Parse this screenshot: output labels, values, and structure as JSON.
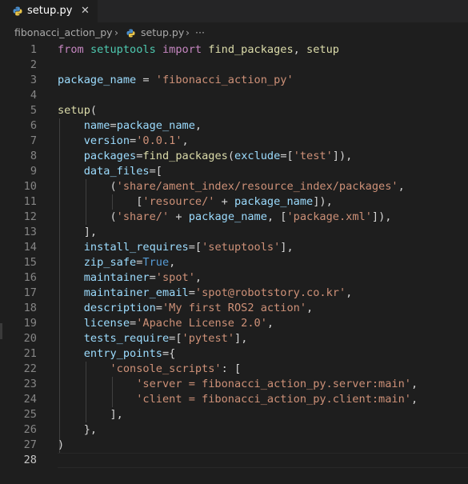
{
  "tab": {
    "label": "setup.py",
    "close": "✕"
  },
  "breadcrumb": {
    "folder": "fibonacci_action_py",
    "sep1": "›",
    "file": "setup.py",
    "sep2": "›",
    "more": "···"
  },
  "editor": {
    "lines": [
      {
        "n": "1",
        "tokens": [
          {
            "t": "from",
            "c": "kw"
          },
          {
            "t": " "
          },
          {
            "t": "setuptools",
            "c": "mod"
          },
          {
            "t": " "
          },
          {
            "t": "import",
            "c": "kw"
          },
          {
            "t": " "
          },
          {
            "t": "find_packages",
            "c": "fn"
          },
          {
            "t": ", "
          },
          {
            "t": "setup",
            "c": "fn"
          }
        ]
      },
      {
        "n": "2",
        "tokens": []
      },
      {
        "n": "3",
        "tokens": [
          {
            "t": "package_name",
            "c": "var"
          },
          {
            "t": " = "
          },
          {
            "t": "'fibonacci_action_py'",
            "c": "str"
          }
        ]
      },
      {
        "n": "4",
        "tokens": []
      },
      {
        "n": "5",
        "tokens": [
          {
            "t": "setup",
            "c": "fn"
          },
          {
            "t": "("
          }
        ]
      },
      {
        "n": "6",
        "tokens": [
          {
            "t": "    "
          },
          {
            "t": "name",
            "c": "var"
          },
          {
            "t": "="
          },
          {
            "t": "package_name",
            "c": "var"
          },
          {
            "t": ","
          }
        ]
      },
      {
        "n": "7",
        "tokens": [
          {
            "t": "    "
          },
          {
            "t": "version",
            "c": "var"
          },
          {
            "t": "="
          },
          {
            "t": "'0.0.1'",
            "c": "str"
          },
          {
            "t": ","
          }
        ]
      },
      {
        "n": "8",
        "tokens": [
          {
            "t": "    "
          },
          {
            "t": "packages",
            "c": "var"
          },
          {
            "t": "="
          },
          {
            "t": "find_packages",
            "c": "fn"
          },
          {
            "t": "("
          },
          {
            "t": "exclude",
            "c": "var"
          },
          {
            "t": "=["
          },
          {
            "t": "'test'",
            "c": "str"
          },
          {
            "t": "]),"
          }
        ]
      },
      {
        "n": "9",
        "tokens": [
          {
            "t": "    "
          },
          {
            "t": "data_files",
            "c": "var"
          },
          {
            "t": "=["
          }
        ]
      },
      {
        "n": "10",
        "tokens": [
          {
            "t": "        ("
          },
          {
            "t": "'share/ament_index/resource_index/packages'",
            "c": "str"
          },
          {
            "t": ","
          }
        ]
      },
      {
        "n": "11",
        "tokens": [
          {
            "t": "            ["
          },
          {
            "t": "'resource/'",
            "c": "str"
          },
          {
            "t": " + "
          },
          {
            "t": "package_name",
            "c": "var"
          },
          {
            "t": "]),"
          }
        ]
      },
      {
        "n": "12",
        "tokens": [
          {
            "t": "        ("
          },
          {
            "t": "'share/'",
            "c": "str"
          },
          {
            "t": " + "
          },
          {
            "t": "package_name",
            "c": "var"
          },
          {
            "t": ", ["
          },
          {
            "t": "'package.xml'",
            "c": "str"
          },
          {
            "t": "]),"
          }
        ]
      },
      {
        "n": "13",
        "tokens": [
          {
            "t": "    ],"
          }
        ]
      },
      {
        "n": "14",
        "tokens": [
          {
            "t": "    "
          },
          {
            "t": "install_requires",
            "c": "var"
          },
          {
            "t": "=["
          },
          {
            "t": "'setuptools'",
            "c": "str"
          },
          {
            "t": "],"
          }
        ]
      },
      {
        "n": "15",
        "tokens": [
          {
            "t": "    "
          },
          {
            "t": "zip_safe",
            "c": "var"
          },
          {
            "t": "="
          },
          {
            "t": "True",
            "c": "bool"
          },
          {
            "t": ","
          }
        ]
      },
      {
        "n": "16",
        "tokens": [
          {
            "t": "    "
          },
          {
            "t": "maintainer",
            "c": "var"
          },
          {
            "t": "="
          },
          {
            "t": "'spot'",
            "c": "str"
          },
          {
            "t": ","
          }
        ]
      },
      {
        "n": "17",
        "tokens": [
          {
            "t": "    "
          },
          {
            "t": "maintainer_email",
            "c": "var"
          },
          {
            "t": "="
          },
          {
            "t": "'spot@robotstory.co.kr'",
            "c": "str"
          },
          {
            "t": ","
          }
        ]
      },
      {
        "n": "18",
        "tokens": [
          {
            "t": "    "
          },
          {
            "t": "description",
            "c": "var"
          },
          {
            "t": "="
          },
          {
            "t": "'My first ROS2 action'",
            "c": "str"
          },
          {
            "t": ","
          }
        ]
      },
      {
        "n": "19",
        "tokens": [
          {
            "t": "    "
          },
          {
            "t": "license",
            "c": "var"
          },
          {
            "t": "="
          },
          {
            "t": "'Apache License 2.0'",
            "c": "str"
          },
          {
            "t": ","
          }
        ]
      },
      {
        "n": "20",
        "tokens": [
          {
            "t": "    "
          },
          {
            "t": "tests_require",
            "c": "var"
          },
          {
            "t": "=["
          },
          {
            "t": "'pytest'",
            "c": "str"
          },
          {
            "t": "],"
          }
        ]
      },
      {
        "n": "21",
        "tokens": [
          {
            "t": "    "
          },
          {
            "t": "entry_points",
            "c": "var"
          },
          {
            "t": "={"
          }
        ]
      },
      {
        "n": "22",
        "tokens": [
          {
            "t": "        "
          },
          {
            "t": "'console_scripts'",
            "c": "str"
          },
          {
            "t": ": ["
          }
        ]
      },
      {
        "n": "23",
        "tokens": [
          {
            "t": "            "
          },
          {
            "t": "'server = fibonacci_action_py.server:main'",
            "c": "str"
          },
          {
            "t": ","
          }
        ]
      },
      {
        "n": "24",
        "tokens": [
          {
            "t": "            "
          },
          {
            "t": "'client = fibonacci_action_py.client:main'",
            "c": "str"
          },
          {
            "t": ","
          }
        ]
      },
      {
        "n": "25",
        "tokens": [
          {
            "t": "        ],"
          }
        ]
      },
      {
        "n": "26",
        "tokens": [
          {
            "t": "    },"
          }
        ]
      },
      {
        "n": "27",
        "tokens": [
          {
            "t": ")"
          }
        ]
      },
      {
        "n": "28",
        "tokens": []
      }
    ],
    "active_line": "28"
  }
}
